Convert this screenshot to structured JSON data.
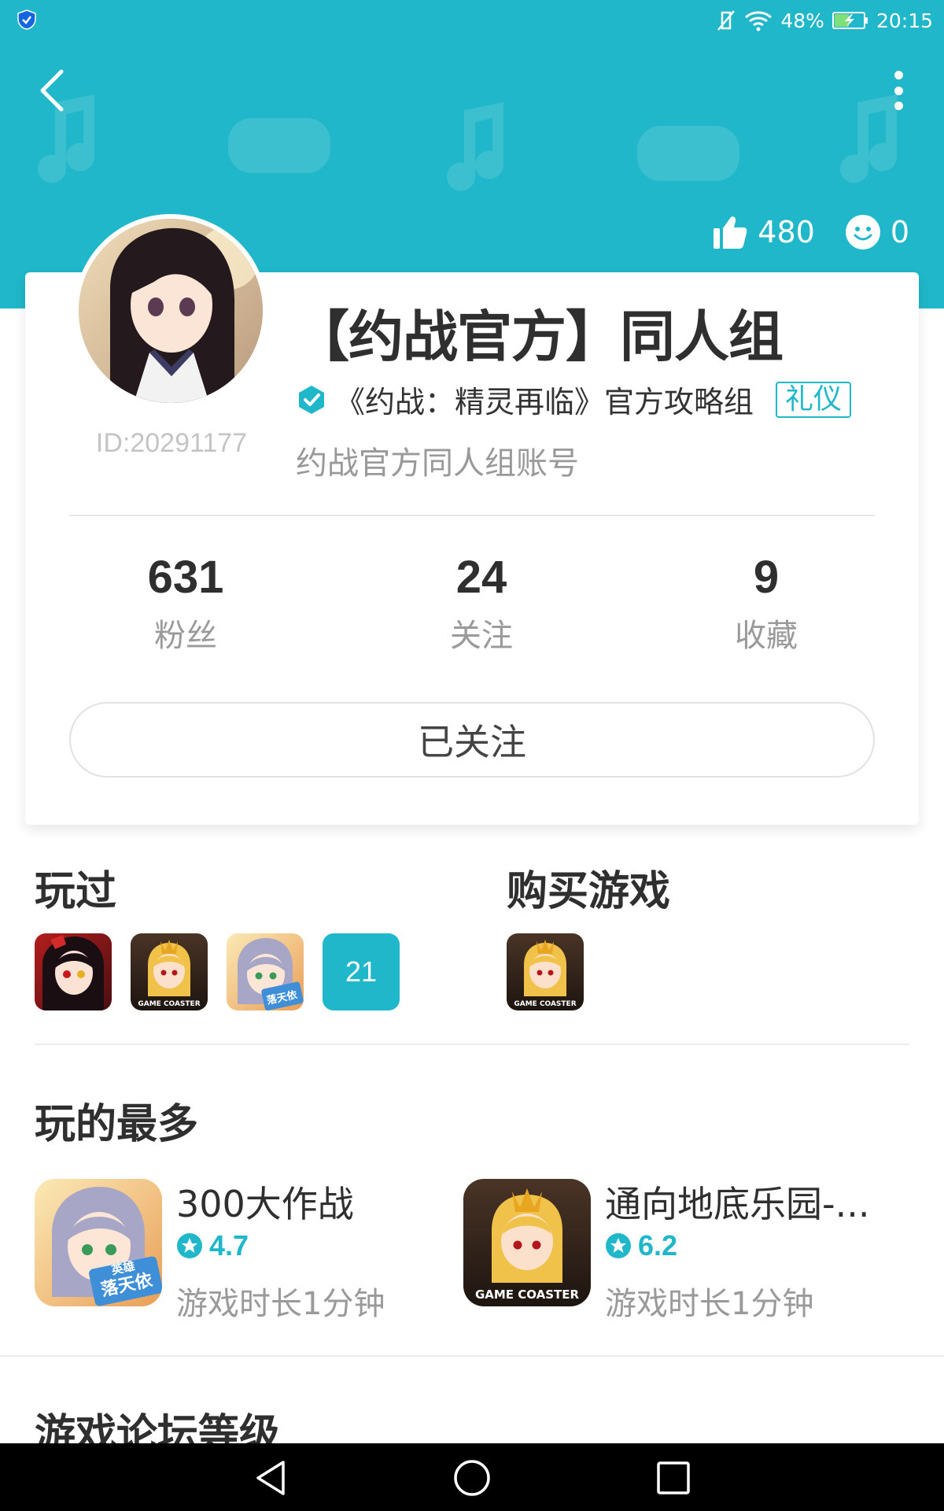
{
  "status_bar": {
    "battery": "48%",
    "time": "20:15"
  },
  "header": {
    "likes": "480",
    "smiles": "0"
  },
  "profile": {
    "name": "【约战官方】同人组",
    "cert": "《约战：精灵再临》官方攻略组",
    "tag": "礼仪",
    "desc": "约战官方同人组账号",
    "id": "ID:20291177"
  },
  "stats": [
    {
      "num": "631",
      "label": "粉丝"
    },
    {
      "num": "24",
      "label": "关注"
    },
    {
      "num": "9",
      "label": "收藏"
    }
  ],
  "follow_button": "已关注",
  "played": {
    "title": "玩过",
    "more": "21"
  },
  "bought": {
    "title": "购买游戏"
  },
  "most_played": {
    "title": "玩的最多",
    "games": [
      {
        "name": "300大作战",
        "rating": "4.7",
        "playtime": "游戏时长1分钟"
      },
      {
        "name": "通向地底乐园-...",
        "rating": "6.2",
        "playtime": "游戏时长1分钟"
      }
    ]
  },
  "forum": {
    "title": "游戏论坛等级"
  },
  "icon_text": {
    "coaster_small": "GAME COASTER",
    "coaster_big": "GAME COASTER",
    "hero_top": "英雄",
    "hero_bottom": "落天依"
  },
  "colors": {
    "accent": "#1fb7c9",
    "text_dark": "#2f2f2f",
    "text_gray": "#9a9a9a"
  }
}
